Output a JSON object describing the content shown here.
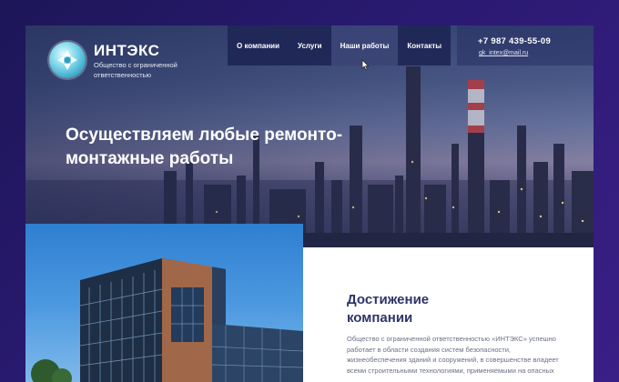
{
  "brand": {
    "name": "ИНТЭКС",
    "subtitle": "Общество с ограниченной ответственностью"
  },
  "nav": {
    "items": [
      {
        "label": "О компании"
      },
      {
        "label": "Услуги"
      },
      {
        "label": "Наши работы"
      },
      {
        "label": "Контакты"
      }
    ],
    "active_index": 2
  },
  "contacts": {
    "phone": "+7 987 439-55-09",
    "email": "gk_intex@mail.ru"
  },
  "hero": {
    "headline": "Осуществляем любые ремонто-монтажные работы"
  },
  "about": {
    "title": "Достижение компании",
    "text": "Общество с ограниченной ответственностью «ИНТЭКС» успешно работает в области создания систем безопасности, жизнеобеспечения зданий и сооружений, в совершенстве владеет всеми строительными технологиями, применяемыми на опасных"
  },
  "colors": {
    "page_bg": "#2a1a72",
    "nav_bg": "#1e2656",
    "accent_title": "#2e3568",
    "logo": "#2f9ec2"
  },
  "icons": {
    "logo": "aperture-logo-icon",
    "cursor": "pointer-cursor-icon"
  }
}
